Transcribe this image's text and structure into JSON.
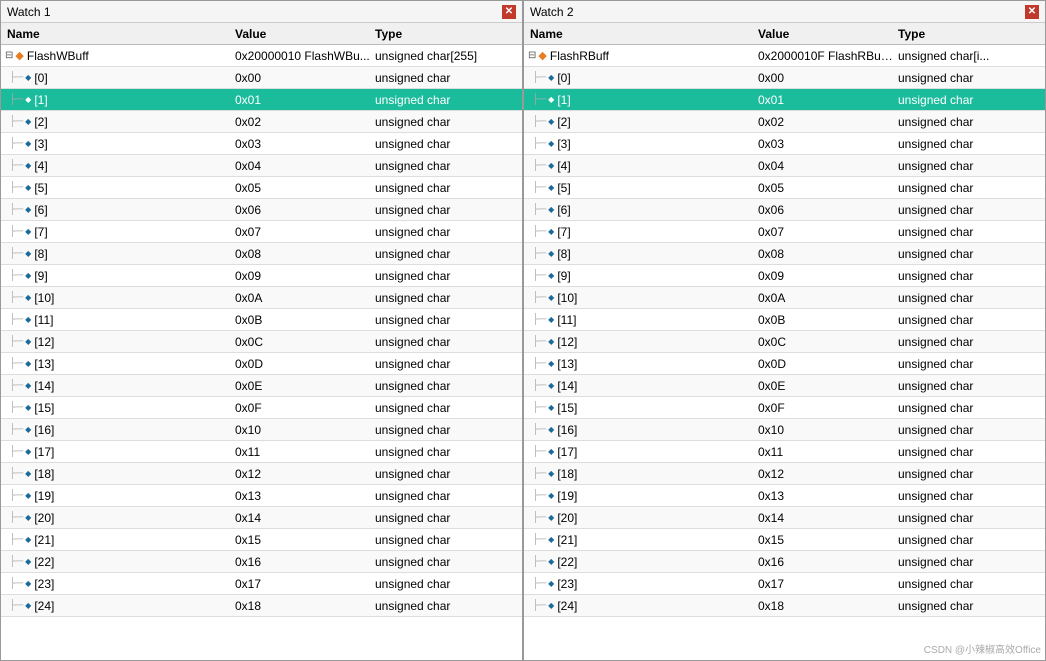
{
  "watch1": {
    "title": "Watch 1",
    "close_label": "✕",
    "columns": [
      "Name",
      "Value",
      "Type"
    ],
    "root": {
      "name": "FlashWBuff",
      "value": "0x20000010 FlashWBu...",
      "type": "unsigned char[255]",
      "expand_icon": "□",
      "icon": "◆"
    },
    "rows": [
      {
        "index": 0,
        "value": "0x00",
        "type": "unsigned char",
        "highlighted": false
      },
      {
        "index": 1,
        "value": "0x01",
        "type": "unsigned char",
        "highlighted": true
      },
      {
        "index": 2,
        "value": "0x02",
        "type": "unsigned char",
        "highlighted": false
      },
      {
        "index": 3,
        "value": "0x03",
        "type": "unsigned char",
        "highlighted": false
      },
      {
        "index": 4,
        "value": "0x04",
        "type": "unsigned char",
        "highlighted": false
      },
      {
        "index": 5,
        "value": "0x05",
        "type": "unsigned char",
        "highlighted": false
      },
      {
        "index": 6,
        "value": "0x06",
        "type": "unsigned char",
        "highlighted": false
      },
      {
        "index": 7,
        "value": "0x07",
        "type": "unsigned char",
        "highlighted": false
      },
      {
        "index": 8,
        "value": "0x08",
        "type": "unsigned char",
        "highlighted": false
      },
      {
        "index": 9,
        "value": "0x09",
        "type": "unsigned char",
        "highlighted": false
      },
      {
        "index": 10,
        "value": "0x0A",
        "type": "unsigned char",
        "highlighted": false
      },
      {
        "index": 11,
        "value": "0x0B",
        "type": "unsigned char",
        "highlighted": false
      },
      {
        "index": 12,
        "value": "0x0C",
        "type": "unsigned char",
        "highlighted": false
      },
      {
        "index": 13,
        "value": "0x0D",
        "type": "unsigned char",
        "highlighted": false
      },
      {
        "index": 14,
        "value": "0x0E",
        "type": "unsigned char",
        "highlighted": false
      },
      {
        "index": 15,
        "value": "0x0F",
        "type": "unsigned char",
        "highlighted": false
      },
      {
        "index": 16,
        "value": "0x10",
        "type": "unsigned char",
        "highlighted": false
      },
      {
        "index": 17,
        "value": "0x11",
        "type": "unsigned char",
        "highlighted": false
      },
      {
        "index": 18,
        "value": "0x12",
        "type": "unsigned char",
        "highlighted": false
      },
      {
        "index": 19,
        "value": "0x13",
        "type": "unsigned char",
        "highlighted": false
      },
      {
        "index": 20,
        "value": "0x14",
        "type": "unsigned char",
        "highlighted": false
      },
      {
        "index": 21,
        "value": "0x15",
        "type": "unsigned char",
        "highlighted": false
      },
      {
        "index": 22,
        "value": "0x16",
        "type": "unsigned char",
        "highlighted": false
      },
      {
        "index": 23,
        "value": "0x17",
        "type": "unsigned char",
        "highlighted": false
      },
      {
        "index": 24,
        "value": "0x18",
        "type": "unsigned char",
        "highlighted": false
      }
    ]
  },
  "watch2": {
    "title": "Watch 2",
    "close_label": "✕",
    "columns": [
      "Name",
      "Value",
      "Type"
    ],
    "root": {
      "name": "FlashRBuff",
      "value": "0x2000010F FlashRBuf...",
      "type": "unsigned char[i...",
      "expand_icon": "□",
      "icon": "◆"
    },
    "rows": [
      {
        "index": 0,
        "value": "0x00",
        "type": "unsigned char",
        "highlighted": false
      },
      {
        "index": 1,
        "value": "0x01",
        "type": "unsigned char",
        "highlighted": true
      },
      {
        "index": 2,
        "value": "0x02",
        "type": "unsigned char",
        "highlighted": false
      },
      {
        "index": 3,
        "value": "0x03",
        "type": "unsigned char",
        "highlighted": false
      },
      {
        "index": 4,
        "value": "0x04",
        "type": "unsigned char",
        "highlighted": false
      },
      {
        "index": 5,
        "value": "0x05",
        "type": "unsigned char",
        "highlighted": false
      },
      {
        "index": 6,
        "value": "0x06",
        "type": "unsigned char",
        "highlighted": false
      },
      {
        "index": 7,
        "value": "0x07",
        "type": "unsigned char",
        "highlighted": false
      },
      {
        "index": 8,
        "value": "0x08",
        "type": "unsigned char",
        "highlighted": false
      },
      {
        "index": 9,
        "value": "0x09",
        "type": "unsigned char",
        "highlighted": false
      },
      {
        "index": 10,
        "value": "0x0A",
        "type": "unsigned char",
        "highlighted": false
      },
      {
        "index": 11,
        "value": "0x0B",
        "type": "unsigned char",
        "highlighted": false
      },
      {
        "index": 12,
        "value": "0x0C",
        "type": "unsigned char",
        "highlighted": false
      },
      {
        "index": 13,
        "value": "0x0D",
        "type": "unsigned char",
        "highlighted": false
      },
      {
        "index": 14,
        "value": "0x0E",
        "type": "unsigned char",
        "highlighted": false
      },
      {
        "index": 15,
        "value": "0x0F",
        "type": "unsigned char",
        "highlighted": false
      },
      {
        "index": 16,
        "value": "0x10",
        "type": "unsigned char",
        "highlighted": false
      },
      {
        "index": 17,
        "value": "0x11",
        "type": "unsigned char",
        "highlighted": false
      },
      {
        "index": 18,
        "value": "0x12",
        "type": "unsigned char",
        "highlighted": false
      },
      {
        "index": 19,
        "value": "0x13",
        "type": "unsigned char",
        "highlighted": false
      },
      {
        "index": 20,
        "value": "0x14",
        "type": "unsigned char",
        "highlighted": false
      },
      {
        "index": 21,
        "value": "0x15",
        "type": "unsigned char",
        "highlighted": false
      },
      {
        "index": 22,
        "value": "0x16",
        "type": "unsigned char",
        "highlighted": false
      },
      {
        "index": 23,
        "value": "0x17",
        "type": "unsigned char",
        "highlighted": false
      },
      {
        "index": 24,
        "value": "0x18",
        "type": "unsigned char",
        "highlighted": false
      }
    ]
  },
  "watermark": "CSDN @小辣椒高效Office"
}
